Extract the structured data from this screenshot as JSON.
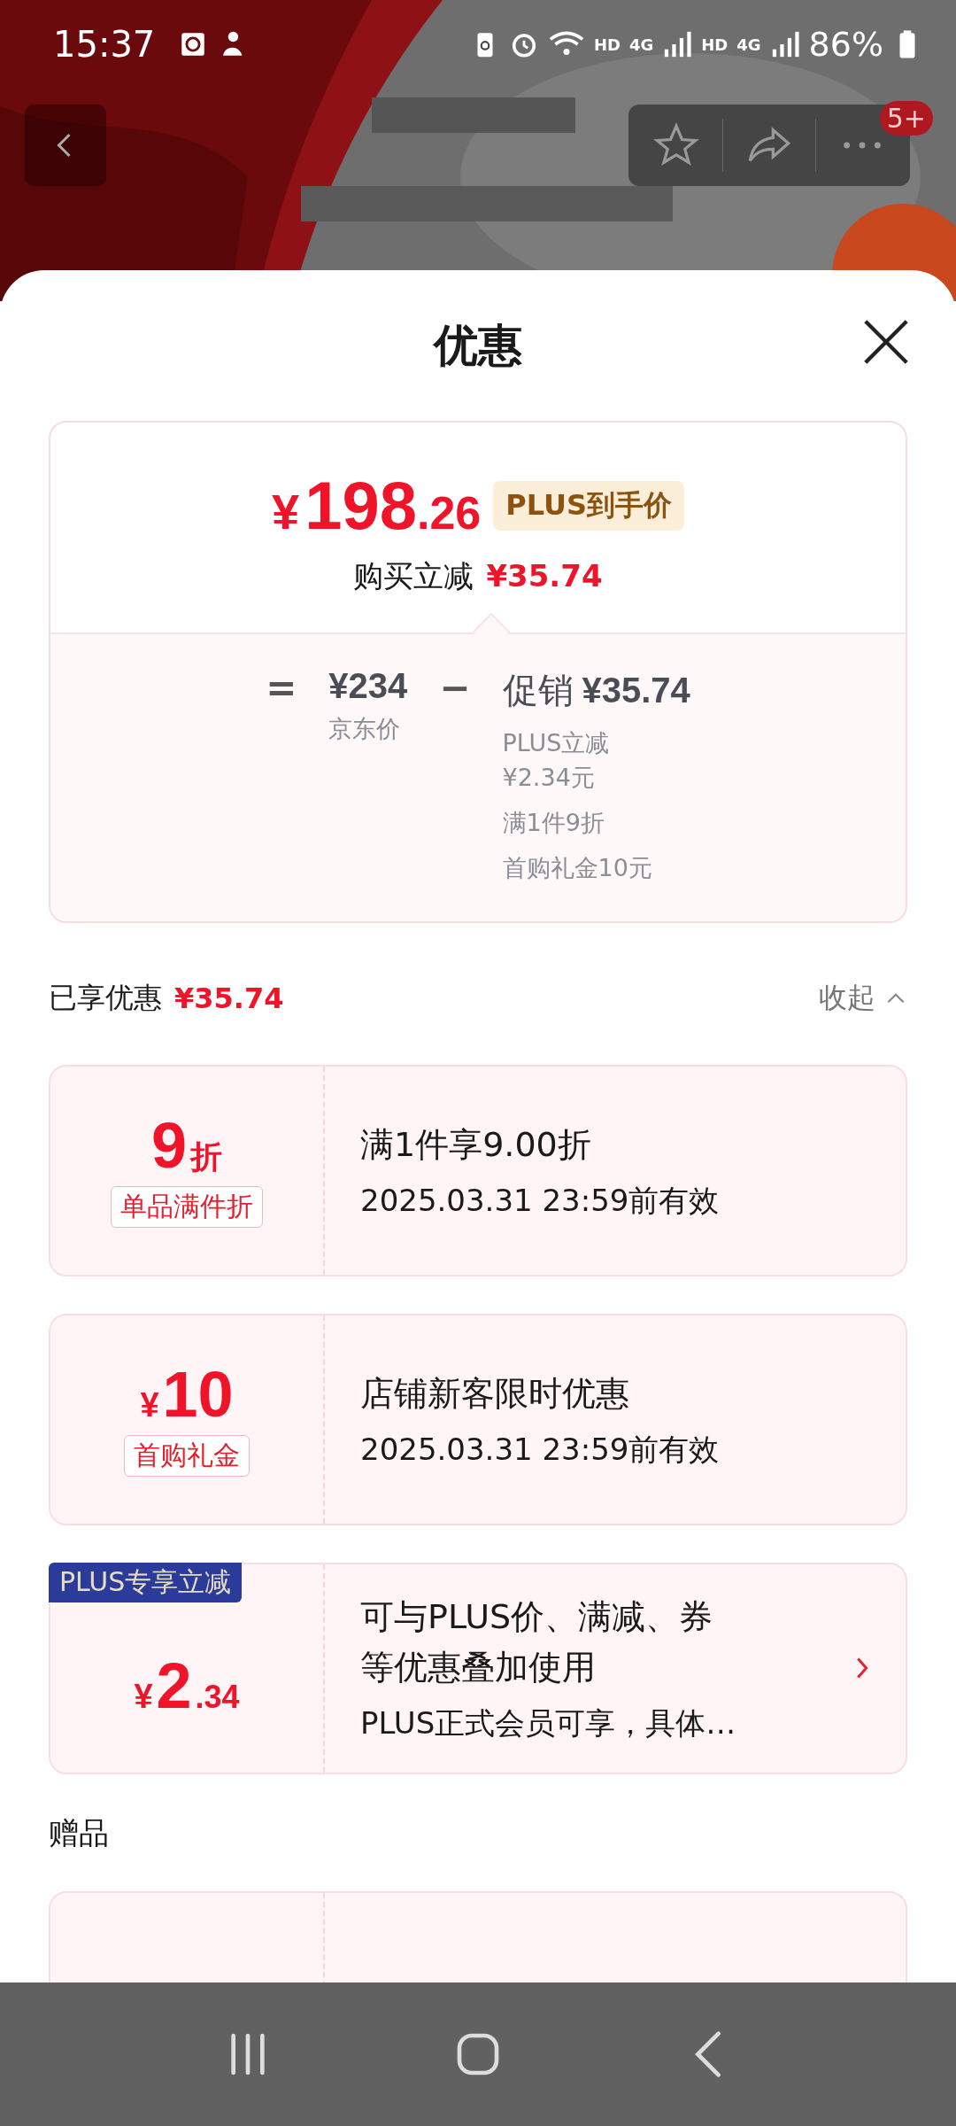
{
  "status_bar": {
    "time": "15:37",
    "network": [
      "HD",
      "4G",
      "HD",
      "4G"
    ],
    "battery": "86%"
  },
  "header": {
    "badge": "5+"
  },
  "sheet": {
    "title": "优惠"
  },
  "price_summary": {
    "currency": "¥",
    "price_int": "198",
    "price_dec": ".26",
    "tag": "PLUS到手价",
    "reduce_label": "购买立减",
    "reduce_amount": "¥35.74",
    "breakdown": {
      "equals": "=",
      "base_price": "¥234",
      "base_label": "京东价",
      "minus": "−",
      "promo_label": "促销",
      "promo_amount": "¥35.74",
      "items": [
        "PLUS立减¥2.34元",
        "满1件9折",
        "首购礼金10元"
      ]
    }
  },
  "applied": {
    "label": "已享优惠",
    "amount": "¥35.74",
    "toggle": "收起",
    "expanded": true
  },
  "coupons": [
    {
      "kind": "discount",
      "amount": "9",
      "suffix": "折",
      "tag": "单品满件折",
      "lines": [
        "满1件享9.00折"
      ],
      "note": "2025.03.31 23:59前有效",
      "arrow": false
    },
    {
      "kind": "cash",
      "prefix": "¥",
      "amount": "10",
      "tag": "首购礼金",
      "lines": [
        "店铺新客限时优惠"
      ],
      "note": "2025.03.31 23:59前有效",
      "arrow": false
    },
    {
      "kind": "plus",
      "ribbon": "PLUS专享立减",
      "prefix": "¥",
      "amount": "2",
      "suffix": ".34",
      "lines": [
        "可与PLUS价、满减、券",
        "等优惠叠加使用"
      ],
      "note": "PLUS正式会员可享，具体…",
      "arrow": true
    }
  ],
  "gifts": {
    "title": "赠品",
    "cards": [
      {
        "kind": "gift"
      }
    ]
  }
}
